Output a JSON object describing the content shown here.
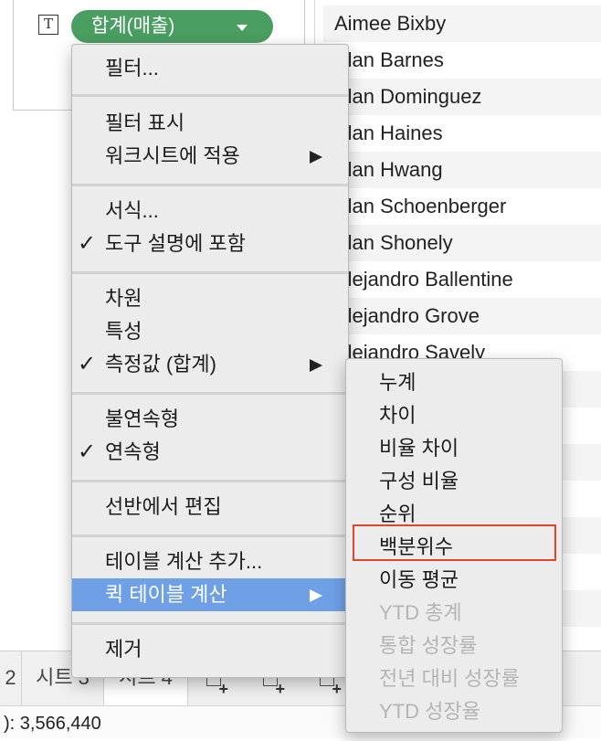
{
  "marks_card": {
    "text_icon": "T",
    "pill_label": "합계(매출)",
    "pill_color": "#4a9e61"
  },
  "names": [
    "Aimee Bixby",
    "Alan Barnes",
    "Alan Dominguez",
    "Alan Haines",
    "Alan Hwang",
    "Alan Schoenberger",
    "Alan Shonely",
    "Alejandro Ballentine",
    "Alejandro Grove",
    "Alejandro Savely"
  ],
  "context_menu": {
    "filter": "필터...",
    "show_filter": "필터 표시",
    "apply_to_worksheets": "워크시트에 적용",
    "format": "서식...",
    "include_in_tooltip": "도구 설명에 포함",
    "dimension": "차원",
    "attribute": "특성",
    "measure_sum": "측정값 (합계)",
    "discrete": "불연속형",
    "continuous": "연속형",
    "edit_in_shelf": "선반에서 편집",
    "add_table_calc": "테이블 계산 추가...",
    "quick_table_calc": "퀵 테이블 계산",
    "remove": "제거",
    "highlight_color": "#6fa0e6"
  },
  "quick_calc_submenu": {
    "items": [
      {
        "label": "누계",
        "enabled": true
      },
      {
        "label": "차이",
        "enabled": true
      },
      {
        "label": "비율 차이",
        "enabled": true
      },
      {
        "label": "구성 비율",
        "enabled": true
      },
      {
        "label": "순위",
        "enabled": true
      },
      {
        "label": "백분위수",
        "enabled": true,
        "outlined": true
      },
      {
        "label": "이동 평균",
        "enabled": true
      },
      {
        "label": "YTD 총계",
        "enabled": false
      },
      {
        "label": "통합 성장률",
        "enabled": false
      },
      {
        "label": "전년 대비 성장률",
        "enabled": false
      },
      {
        "label": "YTD 성장율",
        "enabled": false
      }
    ],
    "outline_color": "#e2442f"
  },
  "sheet_tabs": {
    "partial_tab": "2",
    "sheet3": "시트 3",
    "sheet4": "시트 4"
  },
  "status": {
    "text": "): 3,566,440"
  }
}
